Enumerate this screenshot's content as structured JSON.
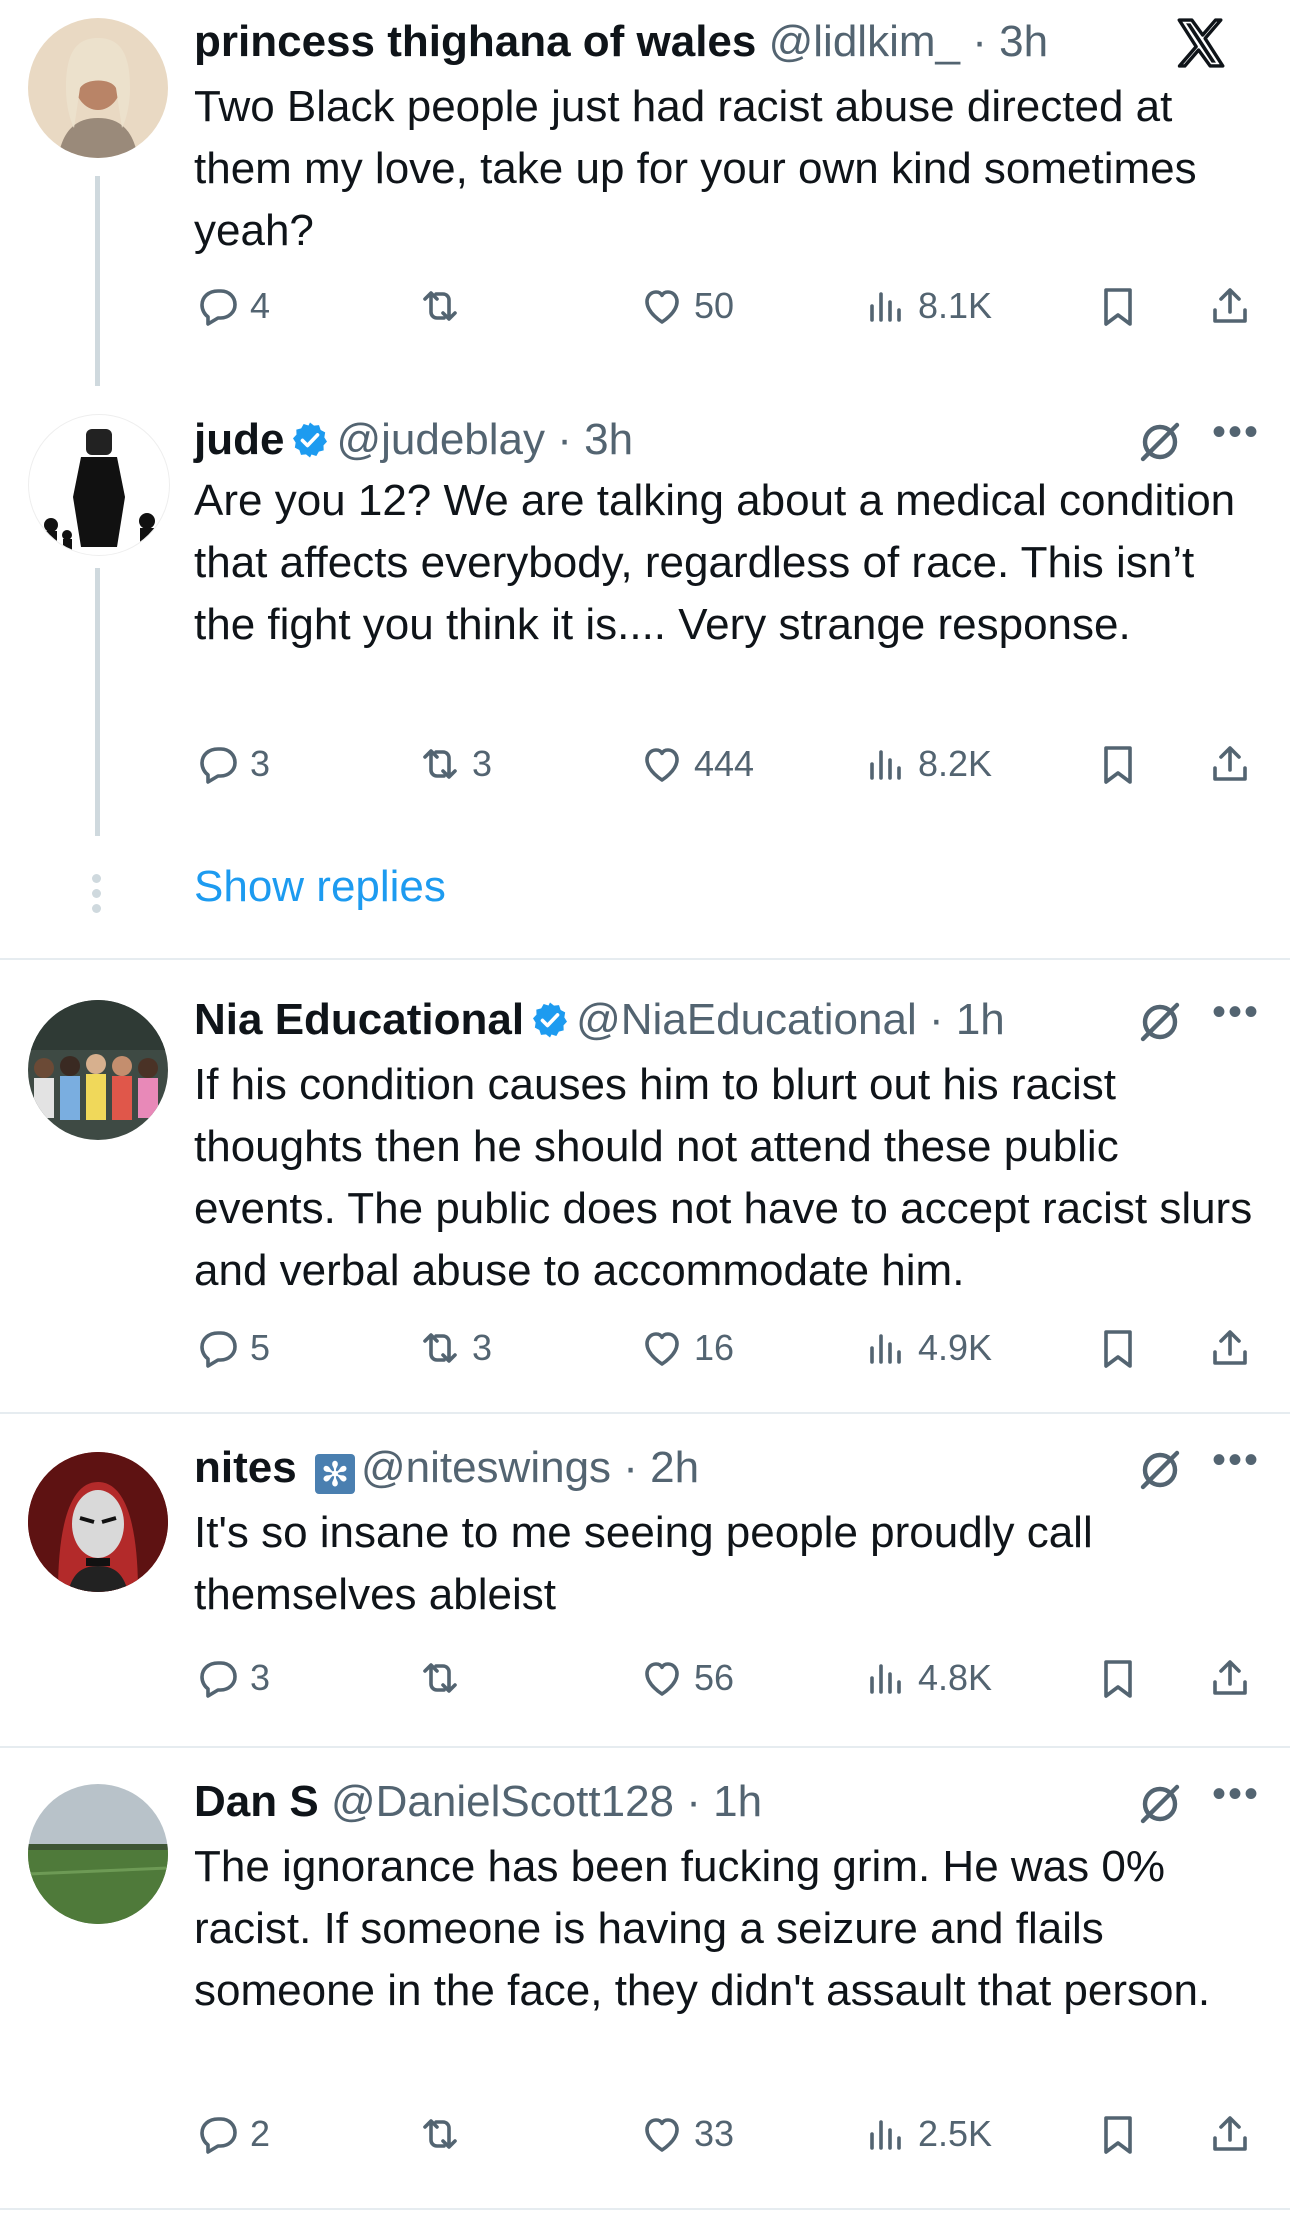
{
  "tweets": [
    {
      "name": "princess thighana of wales",
      "handle": "@lidlkim_",
      "time": "· 3h",
      "text": "Two Black people just had racist abuse directed at them my love, take up for your own kind sometimes yeah?",
      "replies": "4",
      "retweets": "",
      "likes": "50",
      "views": "8.1K"
    },
    {
      "name": "jude",
      "handle": "@judeblay",
      "time": "· 3h",
      "text": "Are you 12? We are talking about a medical condition that affects everybody, regardless of race. This isn’t the fight you think it is.... Very strange response.",
      "replies": "3",
      "retweets": "3",
      "likes": "444",
      "views": "8.2K"
    },
    {
      "name": "Nia Educational",
      "handle": "@NiaEducational",
      "time": "· 1h",
      "text": "If his condition causes him to blurt out his racist thoughts then he should not attend these public events.  The public does not have to accept racist slurs and verbal abuse to accommodate him.",
      "replies": "5",
      "retweets": "3",
      "likes": "16",
      "views": "4.9K"
    },
    {
      "name": "nites",
      "handle": "@niteswings",
      "time": "· 2h",
      "text": "It's so insane to me seeing people proudly call themselves ableist",
      "replies": "3",
      "retweets": "",
      "likes": "56",
      "views": "4.8K"
    },
    {
      "name": "Dan S",
      "handle": "@DanielScott128",
      "time": "· 1h",
      "text": "The ignorance has been fucking grim. He was 0% racist. If someone is having a seizure and flails someone in the face, they didn't assault that person.",
      "replies": "2",
      "retweets": "",
      "likes": "33",
      "views": "2.5K"
    }
  ],
  "show_replies": "Show replies",
  "colors": {
    "accent": "#1d9bf0",
    "muted": "#536471",
    "text": "#0f1419",
    "line": "#cfd9de"
  },
  "icons": [
    "x-logo-icon",
    "reply-icon",
    "retweet-icon",
    "like-icon",
    "views-icon",
    "bookmark-icon",
    "share-icon",
    "grok-icon",
    "more-icon",
    "verified-icon"
  ]
}
